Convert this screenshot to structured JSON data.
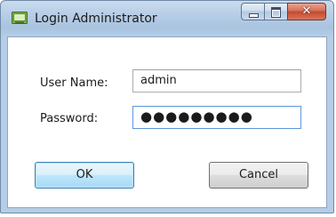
{
  "window": {
    "title": "Login Administrator",
    "icon": "login-app-icon",
    "caption_buttons": {
      "minimize_icon": "minimize-icon",
      "maximize_icon": "maximize-icon",
      "close_icon": "close-icon",
      "close_glyph": "✕"
    }
  },
  "form": {
    "username_label": "User Name:",
    "username_value": "admin",
    "password_label": "Password:",
    "password_value": "●●●●●●●●●"
  },
  "buttons": {
    "ok_label": "OK",
    "cancel_label": "Cancel"
  },
  "colors": {
    "titlebar": "#b9cfe7",
    "close_button": "#c94f36",
    "focus_border": "#5c98d8",
    "default_button_border": "#3c7fb1"
  }
}
